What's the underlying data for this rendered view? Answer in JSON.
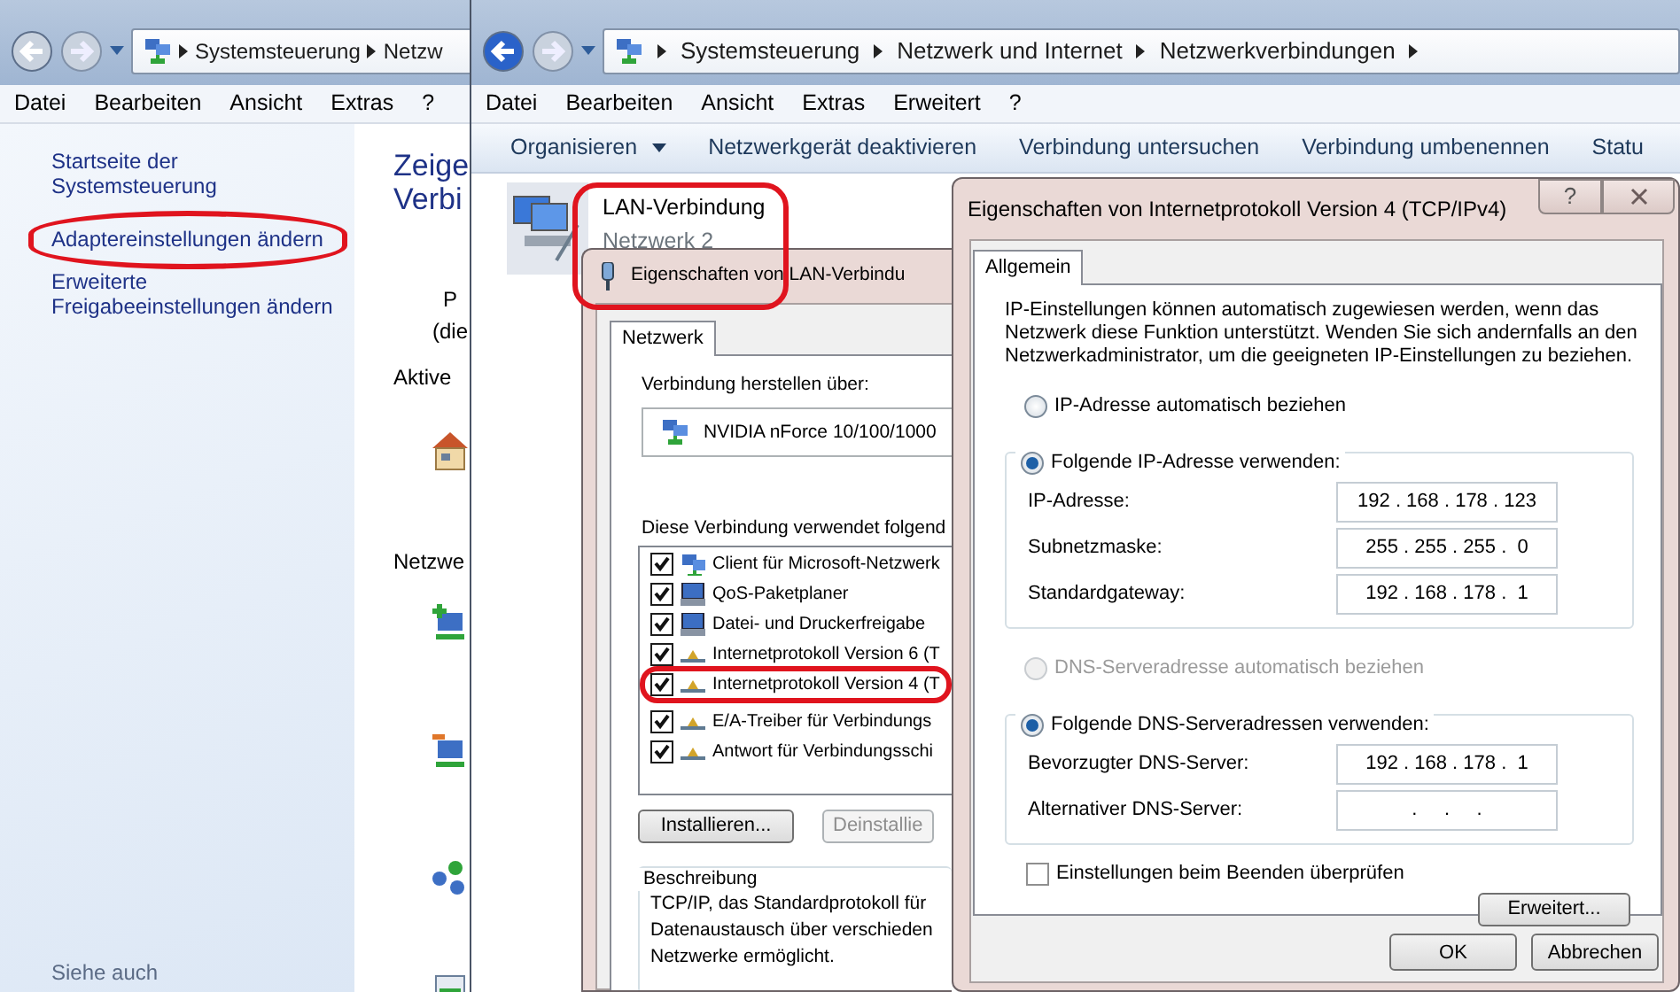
{
  "left_window": {
    "breadcrumb": [
      "Systemsteuerung",
      "Netzw"
    ],
    "menu": [
      "Datei",
      "Bearbeiten",
      "Ansicht",
      "Extras",
      "?"
    ],
    "sidebar_links": [
      {
        "label": "Startseite der Systemsteuerung",
        "highlighted": false
      },
      {
        "label": "Adaptereinstellungen ändern",
        "highlighted": true
      },
      {
        "label": "Erweiterte Freigabeeinstellungen ändern",
        "highlighted": false
      }
    ],
    "see_also": "Siehe auch",
    "heading_lines": [
      "Zeige",
      "Verbi"
    ],
    "text_1": "P",
    "text_2": "(die",
    "active_label": "Aktive",
    "network_label": "Netzwe"
  },
  "main_window": {
    "breadcrumb": [
      "Systemsteuerung",
      "Netzwerk und Internet",
      "Netzwerkverbindungen"
    ],
    "menu": [
      "Datei",
      "Bearbeiten",
      "Ansicht",
      "Extras",
      "Erweitert",
      "?"
    ],
    "commands": [
      {
        "label": "Organisieren",
        "dropdown": true
      },
      {
        "label": "Netzwerkgerät deaktivieren",
        "dropdown": false
      },
      {
        "label": "Verbindung untersuchen",
        "dropdown": false
      },
      {
        "label": "Verbindung umbenennen",
        "dropdown": false
      },
      {
        "label": "Statu",
        "dropdown": false
      }
    ],
    "connection": {
      "name": "LAN-Verbindung",
      "network": "Netzwerk 2",
      "highlighted": true
    }
  },
  "lan_dialog": {
    "title": "Eigenschaften von LAN-Verbindu",
    "tabs": [
      {
        "label": "Netzwerk",
        "selected": true
      }
    ],
    "connect_label": "Verbindung herstellen über:",
    "adapter": "NVIDIA nForce 10/100/1000",
    "components_label": "Diese Verbindung verwendet folgend",
    "components": [
      {
        "kind": "client",
        "label": "Client für Microsoft-Netzwerk",
        "checked": true,
        "highlighted": false
      },
      {
        "kind": "service",
        "label": "QoS-Paketplaner",
        "checked": true,
        "highlighted": false
      },
      {
        "kind": "service",
        "label": "Datei- und Druckerfreigabe",
        "checked": true,
        "highlighted": false
      },
      {
        "kind": "protocol",
        "label": "Internetprotokoll Version 6 (T",
        "checked": true,
        "highlighted": false
      },
      {
        "kind": "protocol",
        "label": "Internetprotokoll Version 4 (T",
        "checked": true,
        "highlighted": true
      },
      {
        "kind": "protocol",
        "label": "E/A-Treiber für Verbindungs",
        "checked": true,
        "highlighted": false
      },
      {
        "kind": "protocol",
        "label": "Antwort für Verbindungsschi",
        "checked": true,
        "highlighted": false
      }
    ],
    "buttons": [
      {
        "label": "Installieren...",
        "disabled": false
      },
      {
        "label": "Deinstallie",
        "disabled": true
      }
    ],
    "description_title": "Beschreibung",
    "description": "TCP/IP, das Standardprotokoll für\nDatenaustausch über verschieden\nNetzwerke ermöglicht."
  },
  "ipv4_dialog": {
    "title": "Eigenschaften von Internetprotokoll Version 4 (TCP/IPv4)",
    "help": "?",
    "tabs": [
      {
        "label": "Allgemein",
        "selected": true
      }
    ],
    "intro": "IP-Einstellungen können automatisch zugewiesen werden, wenn das Netzwerk diese Funktion unterstützt. Wenden Sie sich andernfalls an den Netzwerkadministrator, um die geeigneten IP-Einstellungen zu beziehen.",
    "ip_options": [
      {
        "label": "IP-Adresse automatisch beziehen",
        "selected": false,
        "disabled": false
      },
      {
        "label": "Folgende IP-Adresse verwenden:",
        "selected": true,
        "disabled": false
      }
    ],
    "ip_fields": [
      {
        "label": "IP-Adresse:",
        "value": "192 . 168 . 178 . 123"
      },
      {
        "label": "Subnetzmaske:",
        "value": "255 . 255 . 255 .  0"
      },
      {
        "label": "Standardgateway:",
        "value": "192 . 168 . 178 .  1"
      }
    ],
    "dns_options": [
      {
        "label": "DNS-Serveradresse automatisch beziehen",
        "selected": false,
        "disabled": true
      },
      {
        "label": "Folgende DNS-Serveradressen verwenden:",
        "selected": true,
        "disabled": false
      }
    ],
    "dns_fields": [
      {
        "label": "Bevorzugter DNS-Server:",
        "value": "192 . 168 . 178 .  1"
      },
      {
        "label": "Alternativer DNS-Server:",
        "value": ".     .     ."
      }
    ],
    "verify": {
      "label": "Einstellungen beim Beenden überprüfen",
      "checked": false
    },
    "advanced_button": "Erweitert...",
    "buttons": [
      "OK",
      "Abbrechen"
    ]
  }
}
